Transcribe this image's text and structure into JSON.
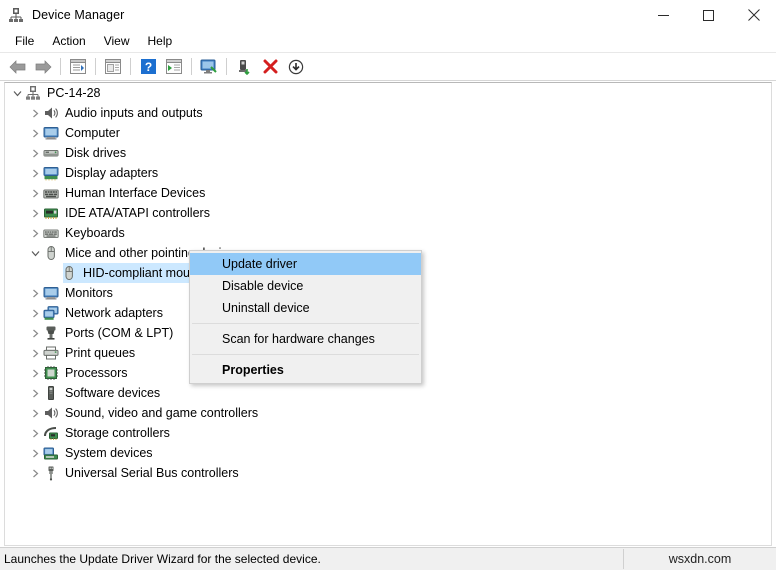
{
  "window": {
    "title": "Device Manager",
    "icon": "device-manager-icon",
    "controls": {
      "minimize": "minimize-icon",
      "maximize": "maximize-icon",
      "close": "close-icon"
    }
  },
  "menubar": {
    "items": [
      {
        "label": "File",
        "name": "menu-file"
      },
      {
        "label": "Action",
        "name": "menu-action"
      },
      {
        "label": "View",
        "name": "menu-view"
      },
      {
        "label": "Help",
        "name": "menu-help"
      }
    ]
  },
  "toolbar": {
    "buttons": [
      {
        "name": "back-button",
        "icon": "back-arrow-icon"
      },
      {
        "name": "forward-button",
        "icon": "forward-arrow-icon"
      },
      {
        "name": "separator-1",
        "icon": "separator"
      },
      {
        "name": "show-hide-console-tree-button",
        "icon": "console-tree-icon"
      },
      {
        "name": "separator-2",
        "icon": "separator"
      },
      {
        "name": "properties-button",
        "icon": "properties-icon"
      },
      {
        "name": "separator-3",
        "icon": "separator"
      },
      {
        "name": "help-button",
        "icon": "help-question-icon"
      },
      {
        "name": "show-hide-action-pane-button",
        "icon": "action-pane-icon"
      },
      {
        "name": "separator-4",
        "icon": "separator"
      },
      {
        "name": "scan-for-hardware-changes-button",
        "icon": "scan-monitor-icon"
      },
      {
        "name": "separator-5",
        "icon": "separator"
      },
      {
        "name": "update-driver-button",
        "icon": "update-driver-icon"
      },
      {
        "name": "uninstall-device-button",
        "icon": "uninstall-red-x-icon"
      },
      {
        "name": "disable-device-button",
        "icon": "disable-down-arrow-icon"
      }
    ]
  },
  "tree": {
    "nodes": [
      {
        "label": "PC-14-28",
        "icon": "computer-root-icon",
        "indent": 0,
        "state": "expanded",
        "selected": false
      },
      {
        "label": "Audio inputs and outputs",
        "icon": "speaker-icon",
        "indent": 1,
        "state": "collapsed",
        "selected": false
      },
      {
        "label": "Computer",
        "icon": "monitor-icon",
        "indent": 1,
        "state": "collapsed",
        "selected": false
      },
      {
        "label": "Disk drives",
        "icon": "disk-drive-icon",
        "indent": 1,
        "state": "collapsed",
        "selected": false
      },
      {
        "label": "Display adapters",
        "icon": "display-adapter-icon",
        "indent": 1,
        "state": "collapsed",
        "selected": false
      },
      {
        "label": "Human Interface Devices",
        "icon": "hid-icon",
        "indent": 1,
        "state": "collapsed",
        "selected": false
      },
      {
        "label": "IDE ATA/ATAPI controllers",
        "icon": "ide-controller-icon",
        "indent": 1,
        "state": "collapsed",
        "selected": false
      },
      {
        "label": "Keyboards",
        "icon": "keyboard-icon",
        "indent": 1,
        "state": "collapsed",
        "selected": false
      },
      {
        "label": "Mice and other pointing devices",
        "icon": "mouse-icon",
        "indent": 1,
        "state": "expanded",
        "selected": false
      },
      {
        "label": "HID-compliant mouse",
        "icon": "mouse-icon",
        "indent": 2,
        "state": "leaf",
        "selected": true
      },
      {
        "label": "Monitors",
        "icon": "monitor-icon",
        "indent": 1,
        "state": "collapsed",
        "selected": false
      },
      {
        "label": "Network adapters",
        "icon": "network-adapter-icon",
        "indent": 1,
        "state": "collapsed",
        "selected": false
      },
      {
        "label": "Ports (COM & LPT)",
        "icon": "port-icon",
        "indent": 1,
        "state": "collapsed",
        "selected": false
      },
      {
        "label": "Print queues",
        "icon": "printer-icon",
        "indent": 1,
        "state": "collapsed",
        "selected": false
      },
      {
        "label": "Processors",
        "icon": "processor-icon",
        "indent": 1,
        "state": "collapsed",
        "selected": false
      },
      {
        "label": "Software devices",
        "icon": "software-device-icon",
        "indent": 1,
        "state": "collapsed",
        "selected": false
      },
      {
        "label": "Sound, video and game controllers",
        "icon": "speaker-icon",
        "indent": 1,
        "state": "collapsed",
        "selected": false
      },
      {
        "label": "Storage controllers",
        "icon": "storage-controller-icon",
        "indent": 1,
        "state": "collapsed",
        "selected": false
      },
      {
        "label": "System devices",
        "icon": "system-device-icon",
        "indent": 1,
        "state": "collapsed",
        "selected": false
      },
      {
        "label": "Universal Serial Bus controllers",
        "icon": "usb-icon",
        "indent": 1,
        "state": "collapsed",
        "selected": false
      }
    ]
  },
  "context_menu": {
    "items": [
      {
        "label": "Update driver",
        "name": "ctx-update-driver",
        "highlighted": true,
        "bold": false,
        "separator_before": false
      },
      {
        "label": "Disable device",
        "name": "ctx-disable-device",
        "highlighted": false,
        "bold": false,
        "separator_before": false
      },
      {
        "label": "Uninstall device",
        "name": "ctx-uninstall-device",
        "highlighted": false,
        "bold": false,
        "separator_before": false
      },
      {
        "label": "Scan for hardware changes",
        "name": "ctx-scan-for-hardware-changes",
        "highlighted": false,
        "bold": false,
        "separator_before": true
      },
      {
        "label": "Properties",
        "name": "ctx-properties",
        "highlighted": false,
        "bold": true,
        "separator_before": true
      }
    ]
  },
  "statusbar": {
    "message": "Launches the Update Driver Wizard for the selected device.",
    "watermark": "wsxdn.com"
  },
  "colors": {
    "menu_highlight": "#91c9f7",
    "tree_selection": "#cce8ff",
    "menu_bg": "#f0f0f0",
    "accent_red": "#d41f1f",
    "accent_blue": "#1c6fd0",
    "accent_green": "#2e9e3e"
  }
}
